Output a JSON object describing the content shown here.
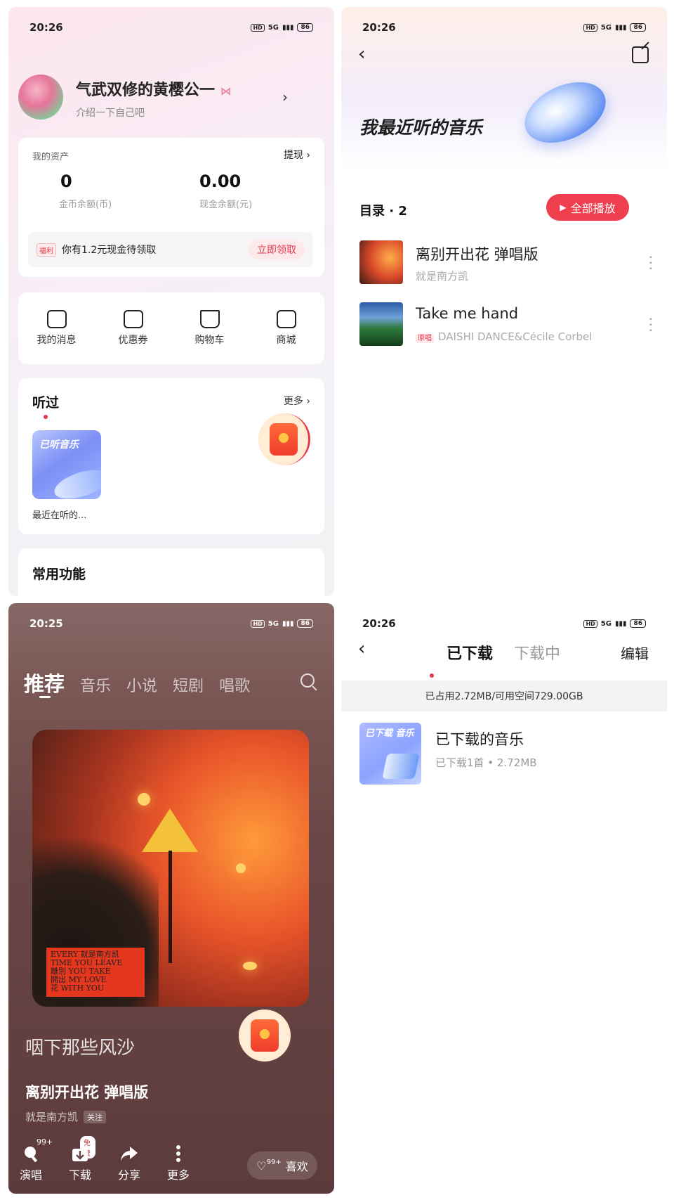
{
  "panel_profile": {
    "status": {
      "time": "20:26",
      "net": "5G",
      "battery": "86"
    },
    "profile": {
      "name": "气武双修的黄樱公一",
      "subtitle": "介绍一下自己吧"
    },
    "assets": {
      "title": "我的资产",
      "withdraw": "提现",
      "coins_value": "0",
      "coins_label": "金币余额(币)",
      "cash_value": "0.00",
      "cash_label": "现金余额(元)",
      "welfare_tag": "福利",
      "welfare_text": "你有1.2元现金待领取",
      "claim_button": "立即领取"
    },
    "shortcuts": [
      {
        "label": "我的消息",
        "icon": "message-icon"
      },
      {
        "label": "优惠券",
        "icon": "coupon-icon"
      },
      {
        "label": "购物车",
        "icon": "cart-icon"
      },
      {
        "label": "商城",
        "icon": "shop-icon"
      }
    ],
    "listened": {
      "title": "听过",
      "more": "更多",
      "album_label": "已听音乐",
      "album_caption": "最近在听的..."
    },
    "common": {
      "title": "常用功能"
    }
  },
  "panel_recent": {
    "status": {
      "time": "20:26",
      "net": "5G",
      "battery": "86"
    },
    "hero_title": "我最近听的音乐",
    "directory_label": "目录 · 2",
    "play_all": "全部播放",
    "songs": [
      {
        "title": "离别开出花 弹唱版",
        "artist": "就是南方凯",
        "tag": ""
      },
      {
        "title": "Take me hand",
        "artist": "DAISHI DANCE&Cécile Corbel",
        "tag": "原唱"
      }
    ]
  },
  "panel_player": {
    "status": {
      "time": "20:25",
      "net": "5G",
      "battery": "86"
    },
    "tabs": [
      "推荐",
      "音乐",
      "小说",
      "短剧",
      "唱歌"
    ],
    "active_tab": "推荐",
    "cover_text": [
      "EVERY 就是南方凯",
      "TIME YOU LEAVE",
      "離別 YOU TAKE",
      "開出 MY LOVE",
      "花 WITH YOU"
    ],
    "lyric": "咽下那些风沙",
    "song_title": "离别开出花 弹唱版",
    "artist": "就是南方凯",
    "follow": "关注",
    "actions": [
      {
        "label": "演唱",
        "badge": "99+",
        "icon": "sing-icon"
      },
      {
        "label": "下载",
        "badge": "免费",
        "icon": "download-icon"
      },
      {
        "label": "分享",
        "badge": "",
        "icon": "share-icon"
      },
      {
        "label": "更多",
        "badge": "",
        "icon": "more-icon"
      }
    ],
    "like": {
      "count": "99+",
      "label": "喜欢"
    }
  },
  "panel_downloads": {
    "status": {
      "time": "20:26",
      "net": "5G",
      "battery": "86"
    },
    "tabs": [
      "已下载",
      "下载中"
    ],
    "active_tab": "已下载",
    "edit": "编辑",
    "storage": "已占用2.72MB/可用空间729.00GB",
    "item": {
      "cover_label": "已下载 音乐",
      "title": "已下载的音乐",
      "subtitle": "已下载1首 • 2.72MB"
    }
  },
  "colors": {
    "accent_red": "#ef3f4f",
    "player_bg": "#6b4646"
  }
}
